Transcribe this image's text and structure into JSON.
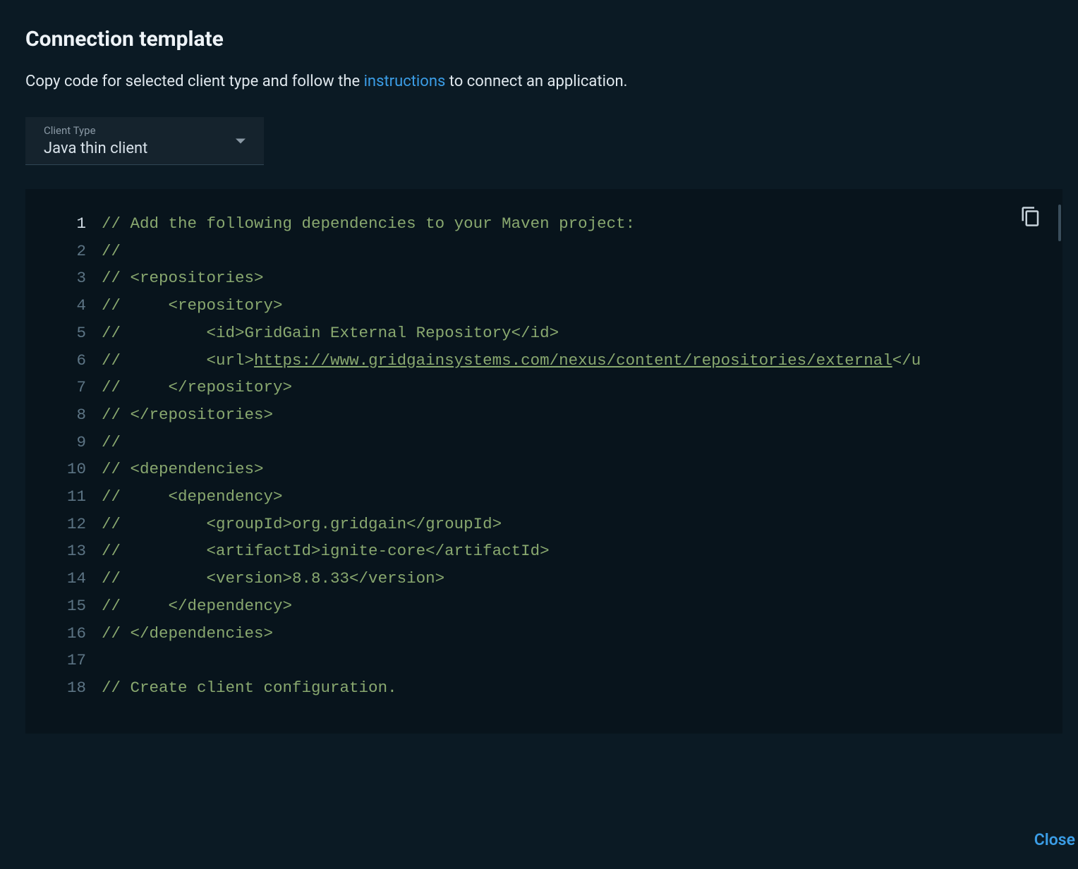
{
  "title": "Connection template",
  "subtitle_pre": "Copy code for selected client type and follow the ",
  "subtitle_link": "instructions",
  "subtitle_post": " to connect an application.",
  "select": {
    "label": "Client Type",
    "value": "Java thin client"
  },
  "close_label": "Close",
  "code_lines": [
    "// Add the following dependencies to your Maven project:",
    "//",
    "// <repositories>",
    "//     <repository>",
    "//         <id>GridGain External Repository</id>",
    "//         <url>https://www.gridgainsystems.com/nexus/content/repositories/external</u",
    "//     </repository>",
    "// </repositories>",
    "//",
    "// <dependencies>",
    "//     <dependency>",
    "//         <groupId>org.gridgain</groupId>",
    "//         <artifactId>ignite-core</artifactId>",
    "//         <version>8.8.33</version>",
    "//     </dependency>",
    "// </dependencies>",
    "",
    "// Create client configuration."
  ],
  "url_in_line_6": "https://www.gridgainsystems.com/nexus/content/repositories/external"
}
